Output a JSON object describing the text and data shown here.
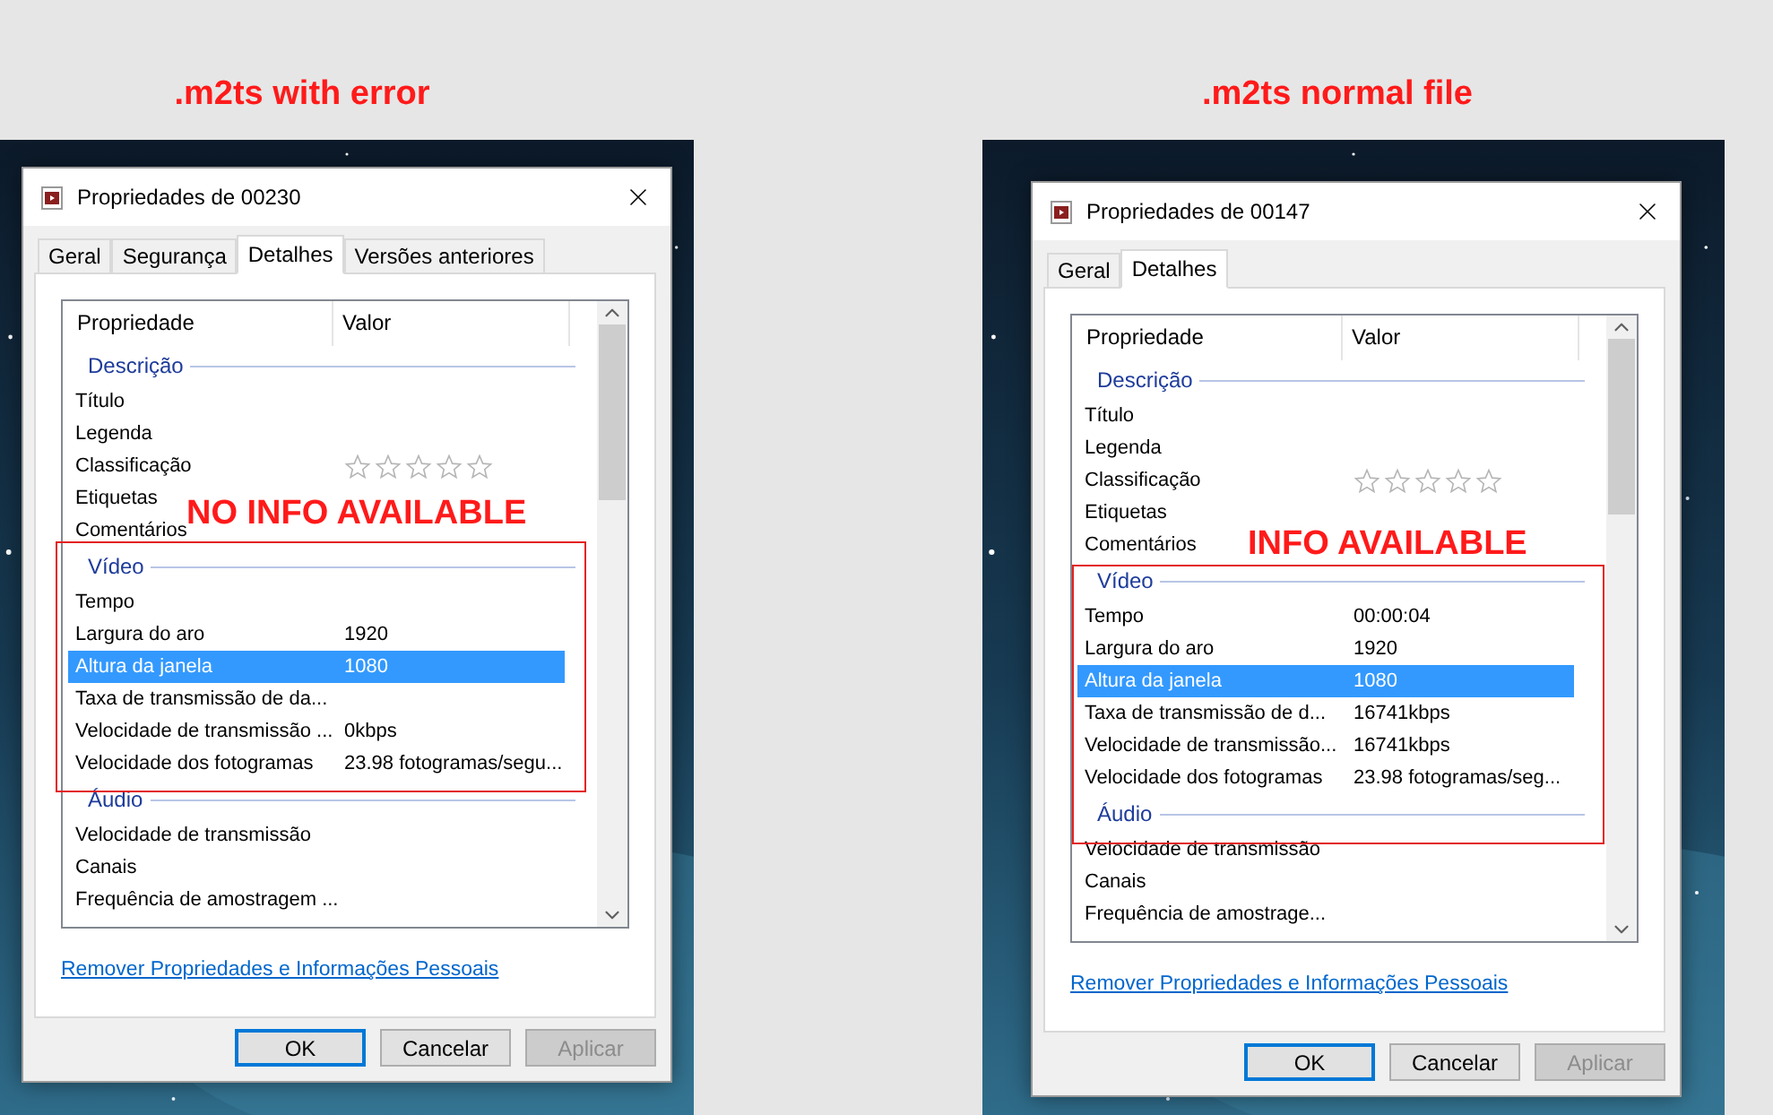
{
  "panels": [
    {
      "caption": ".m2ts with error",
      "annotation": "NO INFO AVAILABLE",
      "dialog": {
        "title": "Propriedades de 00230",
        "tabs": [
          {
            "label": "Geral",
            "selected": false
          },
          {
            "label": "Segurança",
            "selected": false
          },
          {
            "label": "Detalhes",
            "selected": true
          },
          {
            "label": "Versões anteriores",
            "selected": false
          }
        ],
        "columns": [
          "Propriedade",
          "Valor"
        ],
        "groups": [
          {
            "heading": "Descrição",
            "rows": [
              {
                "property": "Título",
                "selected": false
              },
              {
                "property": "Legenda",
                "selected": false
              },
              {
                "property": "Classificação",
                "kind": "rating",
                "stars": 0,
                "selected": false
              },
              {
                "property": "Etiquetas",
                "selected": false
              },
              {
                "property": "Comentários",
                "selected": false
              }
            ]
          },
          {
            "heading": "Vídeo",
            "rows": [
              {
                "property": "Tempo",
                "selected": false
              },
              {
                "property": "Largura do aro",
                "value": "1920",
                "selected": false
              },
              {
                "property": "Altura da janela",
                "value": "1080",
                "selected": true
              },
              {
                "property": "Taxa de transmissão de da...",
                "selected": false
              },
              {
                "property": "Velocidade de transmissão ...",
                "value": "0kbps",
                "selected": false
              },
              {
                "property": "Velocidade dos fotogramas",
                "value": "23.98 fotogramas/segu...",
                "selected": false
              }
            ]
          },
          {
            "heading": "Áudio",
            "rows": [
              {
                "property": "Velocidade de transmissão",
                "selected": false
              },
              {
                "property": "Canais",
                "selected": false
              },
              {
                "property": "Frequência de amostragem ...",
                "selected": false
              }
            ]
          }
        ],
        "link": "Remover Propriedades e Informações Pessoais",
        "buttons": [
          {
            "label": "OK",
            "focused": true,
            "disabled": false
          },
          {
            "label": "Cancelar",
            "focused": false,
            "disabled": false
          },
          {
            "label": "Aplicar",
            "focused": false,
            "disabled": true
          }
        ]
      }
    },
    {
      "caption": ".m2ts normal file",
      "annotation": "INFO AVAILABLE",
      "dialog": {
        "title": "Propriedades de 00147",
        "tabs": [
          {
            "label": "Geral",
            "selected": false
          },
          {
            "label": "Detalhes",
            "selected": true
          }
        ],
        "columns": [
          "Propriedade",
          "Valor"
        ],
        "groups": [
          {
            "heading": "Descrição",
            "rows": [
              {
                "property": "Título",
                "selected": false
              },
              {
                "property": "Legenda",
                "selected": false
              },
              {
                "property": "Classificação",
                "kind": "rating",
                "stars": 0,
                "selected": false
              },
              {
                "property": "Etiquetas",
                "selected": false
              },
              {
                "property": "Comentários",
                "selected": false
              }
            ]
          },
          {
            "heading": "Vídeo",
            "rows": [
              {
                "property": "Tempo",
                "value": "00:00:04",
                "selected": false
              },
              {
                "property": "Largura do aro",
                "value": "1920",
                "selected": false
              },
              {
                "property": "Altura da janela",
                "value": "1080",
                "selected": true
              },
              {
                "property": "Taxa de transmissão de d...",
                "value": "16741kbps",
                "selected": false
              },
              {
                "property": "Velocidade de transmissão...",
                "value": "16741kbps",
                "selected": false
              },
              {
                "property": "Velocidade dos fotogramas",
                "value": "23.98 fotogramas/seg...",
                "selected": false
              }
            ]
          },
          {
            "heading": "Áudio",
            "rows": [
              {
                "property": "Velocidade de transmissão",
                "selected": false
              },
              {
                "property": "Canais",
                "selected": false
              },
              {
                "property": "Frequência de amostrage...",
                "selected": false
              }
            ]
          }
        ],
        "link": "Remover Propriedades e Informações Pessoais",
        "buttons": [
          {
            "label": "OK",
            "focused": true,
            "disabled": false
          },
          {
            "label": "Cancelar",
            "focused": false,
            "disabled": false
          },
          {
            "label": "Aplicar",
            "focused": false,
            "disabled": true
          }
        ]
      }
    }
  ]
}
